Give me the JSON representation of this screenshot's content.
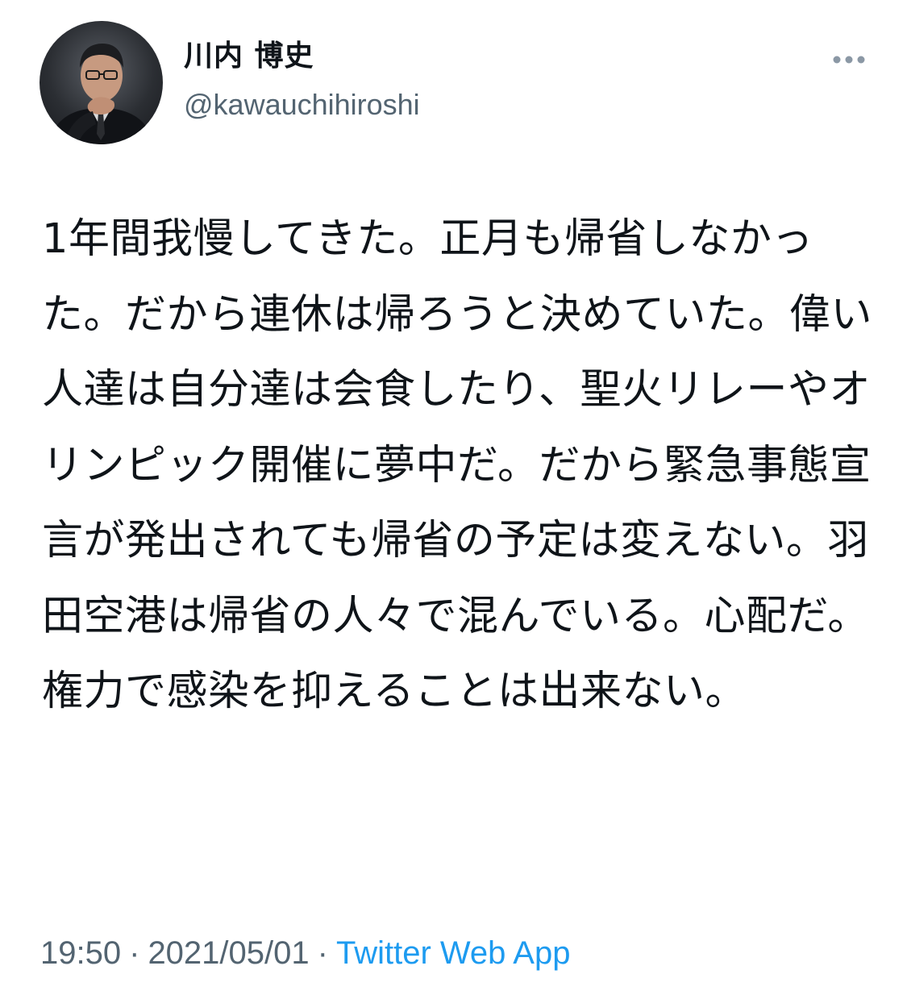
{
  "author": {
    "display_name": "川内 博史",
    "handle": "@kawauchihiroshi"
  },
  "tweet": {
    "text": "1年間我慢してきた。正月も帰省しなかった。だから連休は帰ろうと決めていた。偉い人達は自分達は会食したり、聖火リレーやオリンピック開催に夢中だ。だから緊急事態宣言が発出されても帰省の予定は変えない。羽田空港は帰省の人々で混んでいる。心配だ。権力で感染を抑えることは出来ない。"
  },
  "meta": {
    "time": "19:50",
    "separator": "·",
    "date": "2021/05/01",
    "source": "Twitter Web App"
  },
  "icons": {
    "more": "more-horizontal-icon",
    "avatar": "profile-photo"
  },
  "colors": {
    "text_primary": "#0f1419",
    "text_secondary": "#536471",
    "link": "#1d9bf0",
    "background": "#ffffff"
  }
}
